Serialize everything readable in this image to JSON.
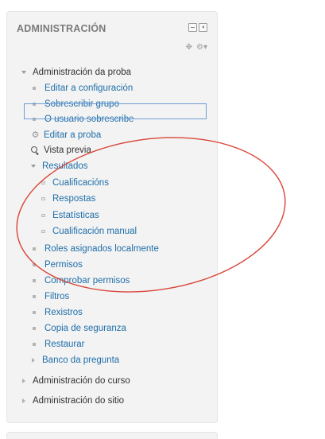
{
  "block": {
    "title": "ADMINISTRACIÓN",
    "items": [
      {
        "label": "Administración da proba",
        "level": 0,
        "marker": "tri-down",
        "style": "dark",
        "name": "quiz-admin"
      },
      {
        "label": "Editar a configuración",
        "level": 1,
        "marker": "bullet",
        "style": "link",
        "name": "edit-settings"
      },
      {
        "label": "Sobrescribir grupo",
        "level": 1,
        "marker": "bullet",
        "style": "link",
        "name": "group-overrides"
      },
      {
        "label": "O usuario sobrescribe",
        "level": 1,
        "marker": "bullet",
        "style": "link",
        "name": "user-overrides"
      },
      {
        "label": "Editar a proba",
        "level": 1,
        "marker": "gear",
        "style": "link",
        "name": "edit-quiz"
      },
      {
        "label": "Vista previa",
        "level": 1,
        "marker": "magnifier",
        "style": "dark",
        "name": "preview"
      },
      {
        "label": "Resultados",
        "level": 1,
        "marker": "tri-down",
        "style": "link",
        "name": "results"
      },
      {
        "label": "Cualificacións",
        "level": 2,
        "marker": "sub-bullet",
        "style": "link",
        "name": "grades"
      },
      {
        "label": "Respostas",
        "level": 2,
        "marker": "sub-bullet",
        "style": "link",
        "name": "responses"
      },
      {
        "label": "Estatísticas",
        "level": 2,
        "marker": "sub-bullet",
        "style": "link",
        "name": "statistics"
      },
      {
        "label": "Cualificación manual",
        "level": 2,
        "marker": "sub-bullet",
        "style": "link",
        "name": "manual-grading"
      },
      {
        "label": "Roles asignados localmente",
        "level": 1,
        "marker": "bullet",
        "style": "link",
        "name": "local-roles"
      },
      {
        "label": "Permisos",
        "level": 1,
        "marker": "bullet",
        "style": "link",
        "name": "permissions"
      },
      {
        "label": "Comprobar permisos",
        "level": 1,
        "marker": "bullet",
        "style": "link",
        "name": "check-permissions"
      },
      {
        "label": "Filtros",
        "level": 1,
        "marker": "bullet",
        "style": "link",
        "name": "filters"
      },
      {
        "label": "Rexistros",
        "level": 1,
        "marker": "bullet",
        "style": "link",
        "name": "logs"
      },
      {
        "label": "Copia de seguranza",
        "level": 1,
        "marker": "bullet",
        "style": "link",
        "name": "backup"
      },
      {
        "label": "Restaurar",
        "level": 1,
        "marker": "bullet",
        "style": "link",
        "name": "restore"
      },
      {
        "label": "Banco da pregunta",
        "level": 1,
        "marker": "tri-right",
        "style": "link",
        "name": "question-bank"
      },
      {
        "label": "Administración do curso",
        "level": 0,
        "marker": "tri-right",
        "style": "dark",
        "name": "course-admin"
      },
      {
        "label": "Administración do sitio",
        "level": 0,
        "marker": "tri-right",
        "style": "dark",
        "name": "site-admin"
      }
    ]
  },
  "colors": {
    "link": "#1f6ea8",
    "annotation": "#d9463a",
    "selection": "#6d9fd6"
  }
}
